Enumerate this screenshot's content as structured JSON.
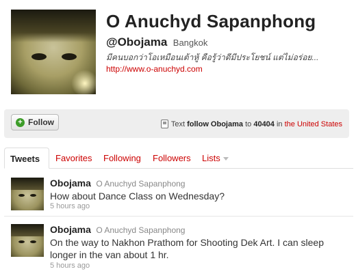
{
  "profile": {
    "name": "O Anuchyd Sapanphong",
    "handle": "@Obojama",
    "location": "Bangkok",
    "bio": "มีคนบอกว่าโอเหมือนเต้าหู้ คือรู้ว่าดีมีประโยชน์ แต่ไม่อร่อย...",
    "url": "http://www.o-anuchyd.com"
  },
  "actions": {
    "follow_label": "Follow",
    "text_prefix": "Text",
    "text_command": "follow Obojama",
    "text_to": "to",
    "text_number": "40404",
    "text_in": "in",
    "text_region": "the United States"
  },
  "tabs": [
    {
      "label": "Tweets",
      "active": true
    },
    {
      "label": "Favorites"
    },
    {
      "label": "Following"
    },
    {
      "label": "Followers"
    },
    {
      "label": "Lists"
    }
  ],
  "tweets": [
    {
      "user": "Obojama",
      "full_name": "O Anuchyd Sapanphong",
      "text": "How about Dance Class on Wednesday?",
      "time": "5 hours ago"
    },
    {
      "user": "Obojama",
      "full_name": "O Anuchyd Sapanphong",
      "text": "On the way to Nakhon Prathom for Shooting Dek Art. I can sleep longer in the van about 1 hr.",
      "time": "5 hours ago"
    }
  ],
  "colors": {
    "link": "#cc0000",
    "follow_icon": "#3d9c29",
    "bar_bg": "#eeeeee"
  },
  "icons": {
    "follow": "plus-circle-icon",
    "text": "phone-icon",
    "lists": "caret-down-icon"
  }
}
